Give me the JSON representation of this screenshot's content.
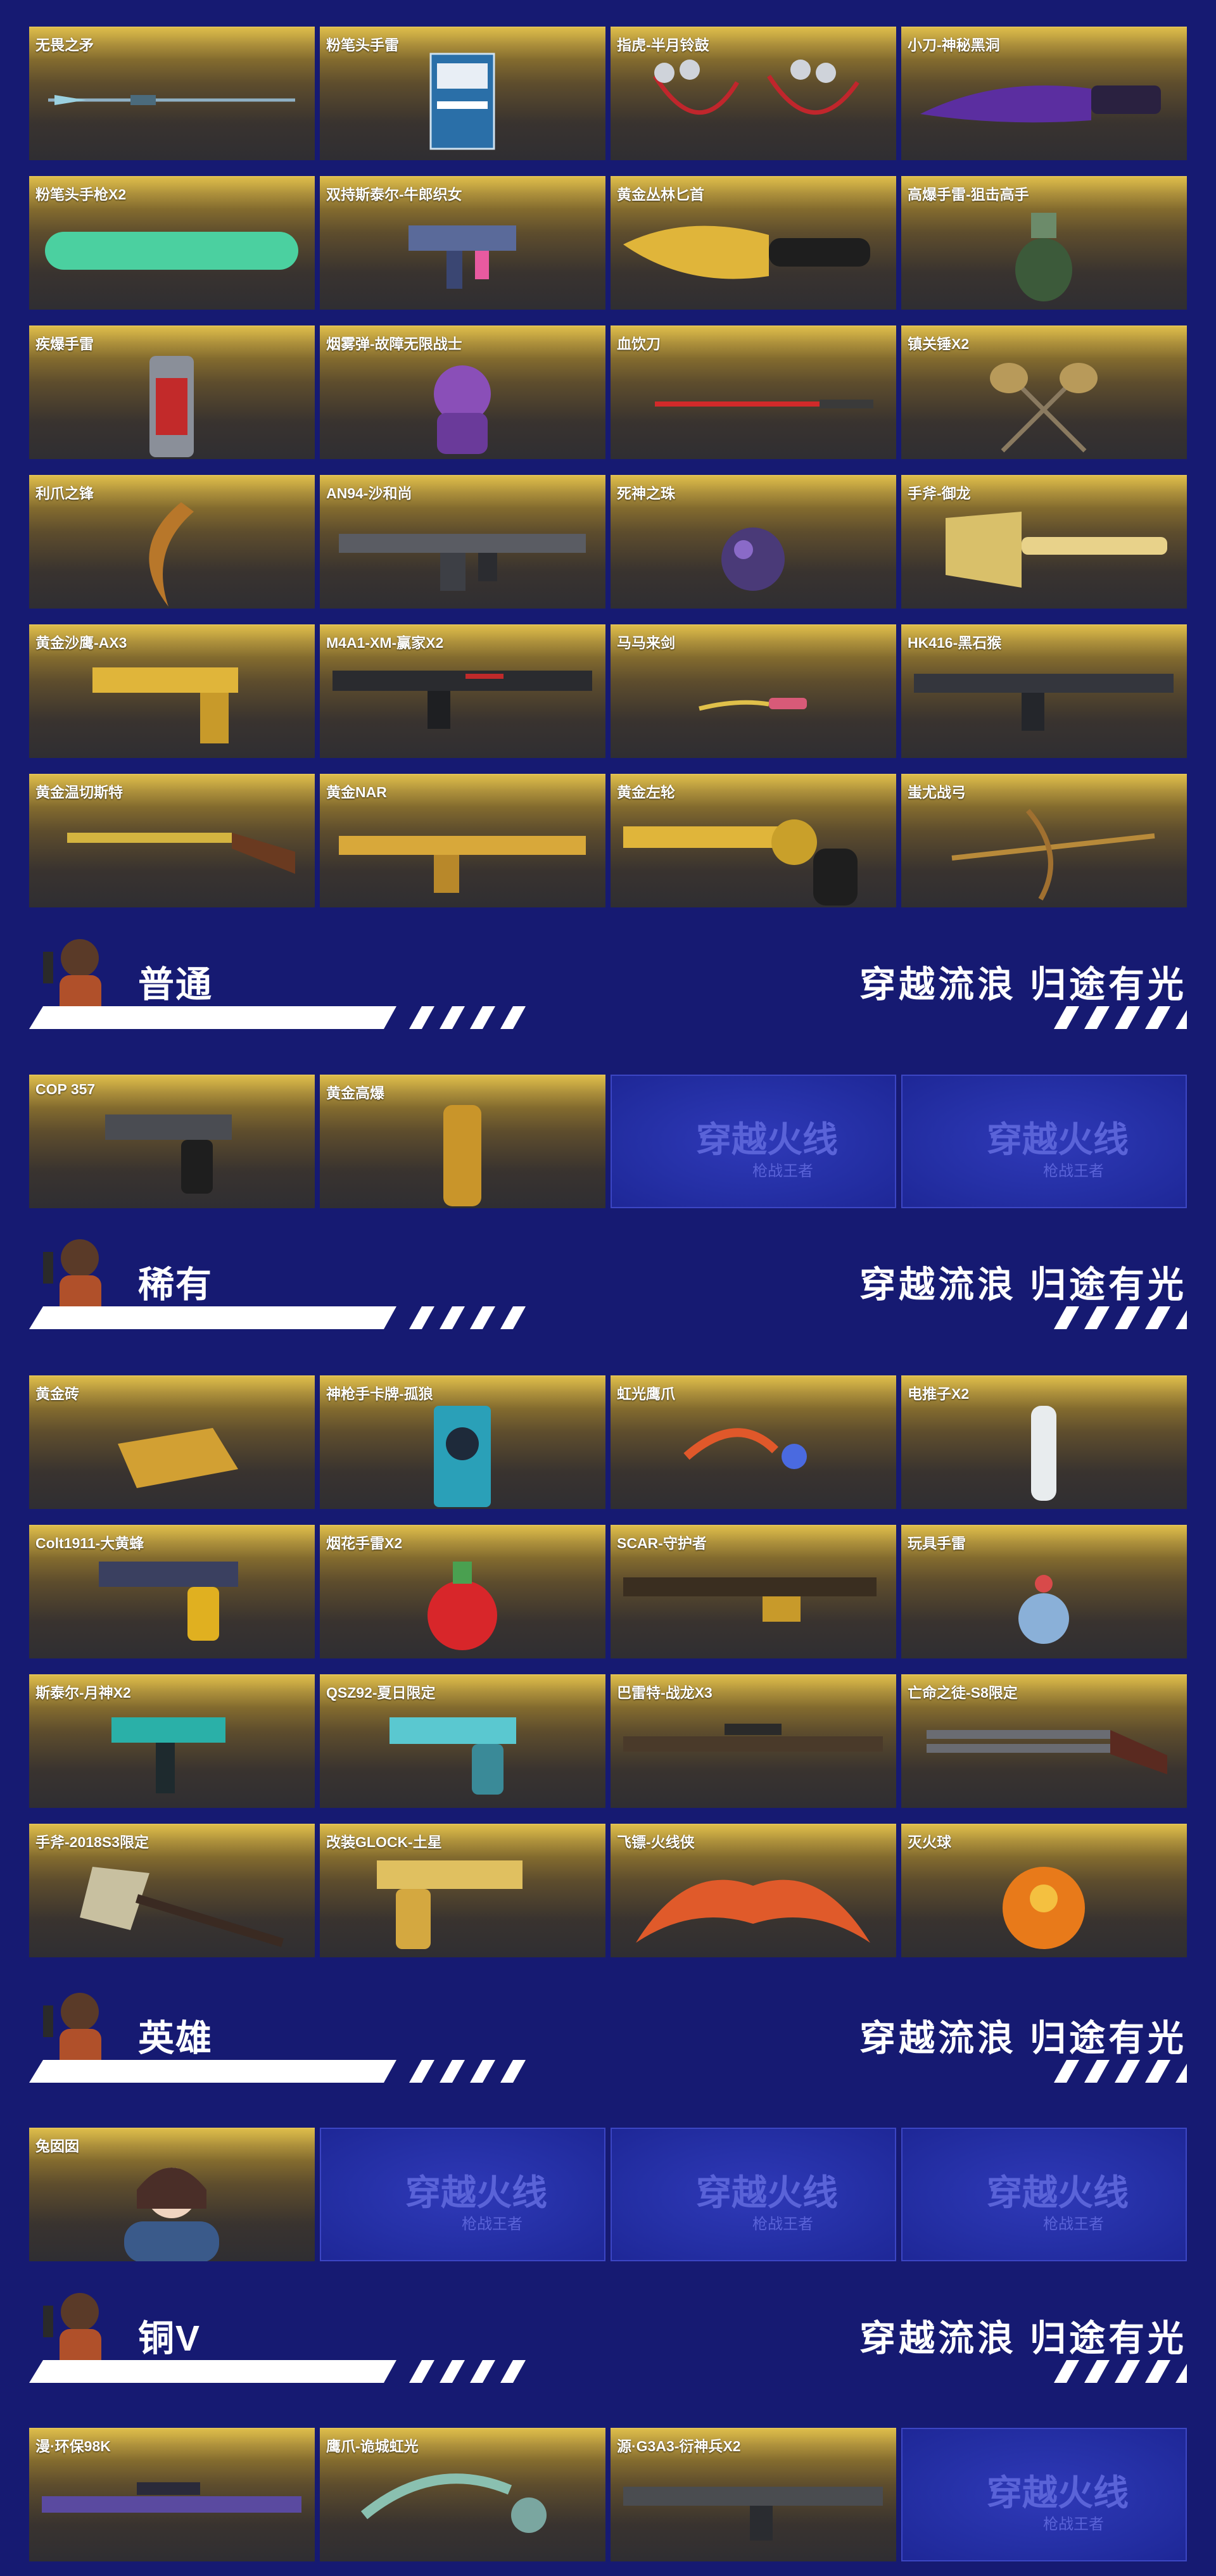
{
  "sections": {
    "top": {
      "items": [
        {
          "label": "无畏之矛",
          "icon": "spear-icon"
        },
        {
          "label": "粉笔头手雷",
          "icon": "chalk-box-icon"
        },
        {
          "label": "指虎-半月铃鼓",
          "icon": "knuckle-duster-icon"
        },
        {
          "label": "小刀-神秘黑洞",
          "icon": "knife-icon"
        },
        {
          "label": "粉笔头手枪X2",
          "icon": "chalk-stick-icon"
        },
        {
          "label": "双持斯泰尔-牛郎织女",
          "icon": "smg-icon"
        },
        {
          "label": "黄金丛林匕首",
          "icon": "golden-knife-icon"
        },
        {
          "label": "高爆手雷-狙击高手",
          "icon": "grenade-icon"
        },
        {
          "label": "疾爆手雷",
          "icon": "canister-grenade-icon"
        },
        {
          "label": "烟雾弹-故障无限战士",
          "icon": "robot-figure-icon"
        },
        {
          "label": "血饮刀",
          "icon": "blade-icon"
        },
        {
          "label": "镇关锤X2",
          "icon": "hammers-icon"
        },
        {
          "label": "利爪之锋",
          "icon": "claw-blade-icon"
        },
        {
          "label": "AN94-沙和尚",
          "icon": "rifle-icon"
        },
        {
          "label": "死神之珠",
          "icon": "orb-icon"
        },
        {
          "label": "手斧-御龙",
          "icon": "axe-icon"
        },
        {
          "label": "黄金沙鹰-AX3",
          "icon": "golden-pistol-icon"
        },
        {
          "label": "M4A1-XM-赢家X2",
          "icon": "rifle-icon"
        },
        {
          "label": "马马来剑",
          "icon": "sword-icon"
        },
        {
          "label": "HK416-黑石猴",
          "icon": "rifle-icon"
        },
        {
          "label": "黄金温切斯特",
          "icon": "shotgun-icon"
        },
        {
          "label": "黄金NAR",
          "icon": "golden-rifle-icon"
        },
        {
          "label": "黄金左轮",
          "icon": "revolver-icon"
        },
        {
          "label": "蚩尤战弓",
          "icon": "bow-icon"
        }
      ]
    },
    "putong": {
      "title": "普通",
      "slogan": "穿越流浪 归途有光",
      "items": [
        {
          "label": "COP 357",
          "icon": "pistol-icon"
        },
        {
          "label": "黄金高爆",
          "icon": "golden-grenade-icon"
        }
      ],
      "logo_slots": 2
    },
    "xiyou": {
      "title": "稀有",
      "slogan": "穿越流浪 归途有光",
      "items": [
        {
          "label": "黄金砖",
          "icon": "gold-brick-icon"
        },
        {
          "label": "神枪手卡牌-孤狼",
          "icon": "player-card-icon"
        },
        {
          "label": "虹光鹰爪",
          "icon": "karambit-icon"
        },
        {
          "label": "电推子X2",
          "icon": "clipper-icon"
        },
        {
          "label": "Colt1911-大黄蜂",
          "icon": "pistol-icon"
        },
        {
          "label": "烟花手雷X2",
          "icon": "firework-grenade-icon"
        },
        {
          "label": "SCAR-守护者",
          "icon": "rifle-icon"
        },
        {
          "label": "玩具手雷",
          "icon": "toy-grenade-icon"
        },
        {
          "label": "斯泰尔-月神X2",
          "icon": "smg-icon"
        },
        {
          "label": "QSZ92-夏日限定",
          "icon": "pistol-icon"
        },
        {
          "label": "巴雷特-战龙X3",
          "icon": "sniper-icon"
        },
        {
          "label": "亡命之徒-S8限定",
          "icon": "double-barrel-icon"
        },
        {
          "label": "手斧-2018S3限定",
          "icon": "axe-icon"
        },
        {
          "label": "改装GLOCK-土星",
          "icon": "golden-pistol-icon"
        },
        {
          "label": "飞镖-火线侠",
          "icon": "bat-blade-icon"
        },
        {
          "label": "灭火球",
          "icon": "fire-ball-icon"
        }
      ]
    },
    "yingxiong": {
      "title": "英雄",
      "slogan": "穿越流浪 归途有光",
      "items": [
        {
          "label": "兔囡囡",
          "icon": "character-portrait-icon"
        }
      ],
      "logo_slots": 3
    },
    "tongv": {
      "title": "铜V",
      "slogan": "穿越流浪 归途有光",
      "items": [
        {
          "label": "漫·环保98K",
          "icon": "sniper-icon"
        },
        {
          "label": "鹰爪-诡城虹光",
          "icon": "karambit-icon"
        },
        {
          "label": "源·G3A3-衍神兵X2",
          "icon": "rifle-icon"
        }
      ],
      "logo_slots": 1
    }
  },
  "logo": {
    "main": "穿越火线",
    "sub": "枪战王者"
  },
  "colors": {
    "background": "#161a72",
    "card_gold": "#c9a431",
    "card_dark": "#2f2e32",
    "logo_tile": "#2530a6",
    "text": "#ffffff"
  }
}
